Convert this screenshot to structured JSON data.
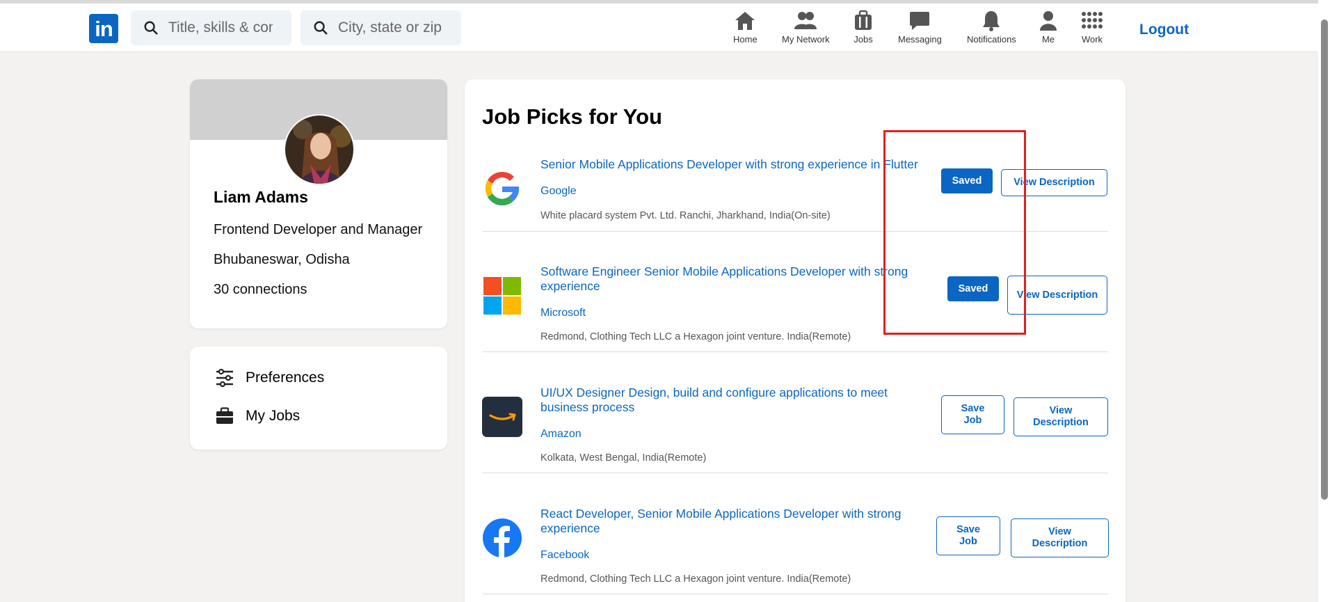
{
  "header": {
    "logo_text": "in",
    "search_title_placeholder": "Title, skills & com",
    "search_location_placeholder": "City, state or zip",
    "nav": [
      {
        "label": "Home",
        "icon": "home-icon"
      },
      {
        "label": "My Network",
        "icon": "network-icon"
      },
      {
        "label": "Jobs",
        "icon": "briefcase-icon"
      },
      {
        "label": "Messaging",
        "icon": "message-icon"
      },
      {
        "label": "Notifications",
        "icon": "bell-icon"
      },
      {
        "label": "Me",
        "icon": "person-icon"
      },
      {
        "label": "Work",
        "icon": "grid-icon"
      }
    ],
    "logout_label": "Logout"
  },
  "profile": {
    "name": "Liam Adams",
    "headline": "Frontend Developer and Manager",
    "location": "Bhubaneswar, Odisha",
    "connections": "30 connections"
  },
  "menu": {
    "preferences_label": "Preferences",
    "my_jobs_label": "My Jobs"
  },
  "jobs": {
    "heading": "Job Picks for You",
    "items": [
      {
        "title": "Senior Mobile Applications Developer with strong experience in Flutter",
        "company": "Google",
        "location": "White placard system Pvt. Ltd. Ranchi, Jharkhand, India(On-site)",
        "save_label": "Saved",
        "saved": true,
        "view_label": "View Description",
        "logo": "google-logo-icon"
      },
      {
        "title": "Software Engineer Senior Mobile Applications Developer with strong experience",
        "company": "Microsoft",
        "location": "Redmond, Clothing Tech LLC a Hexagon joint venture. India(Remote)",
        "save_label": "Saved",
        "saved": true,
        "view_label": "View Description",
        "logo": "microsoft-logo-icon"
      },
      {
        "title": "UI/UX Designer Design, build and configure applications to meet business process",
        "company": "Amazon",
        "location": "Kolkata, West Bengal, India(Remote)",
        "save_label": "Save Job",
        "saved": false,
        "view_label": "View Description",
        "logo": "amazon-logo-icon"
      },
      {
        "title": "React Developer, Senior Mobile Applications Developer with strong experience",
        "company": "Facebook",
        "location": "Redmond, Clothing Tech LLC a Hexagon joint venture. India(Remote)",
        "save_label": "Save Job",
        "saved": false,
        "view_label": "View Description",
        "logo": "facebook-logo-icon"
      }
    ]
  },
  "colors": {
    "accent": "#0a66c2",
    "highlight_box": "#e02020",
    "page_bg": "#f3f2f0"
  }
}
